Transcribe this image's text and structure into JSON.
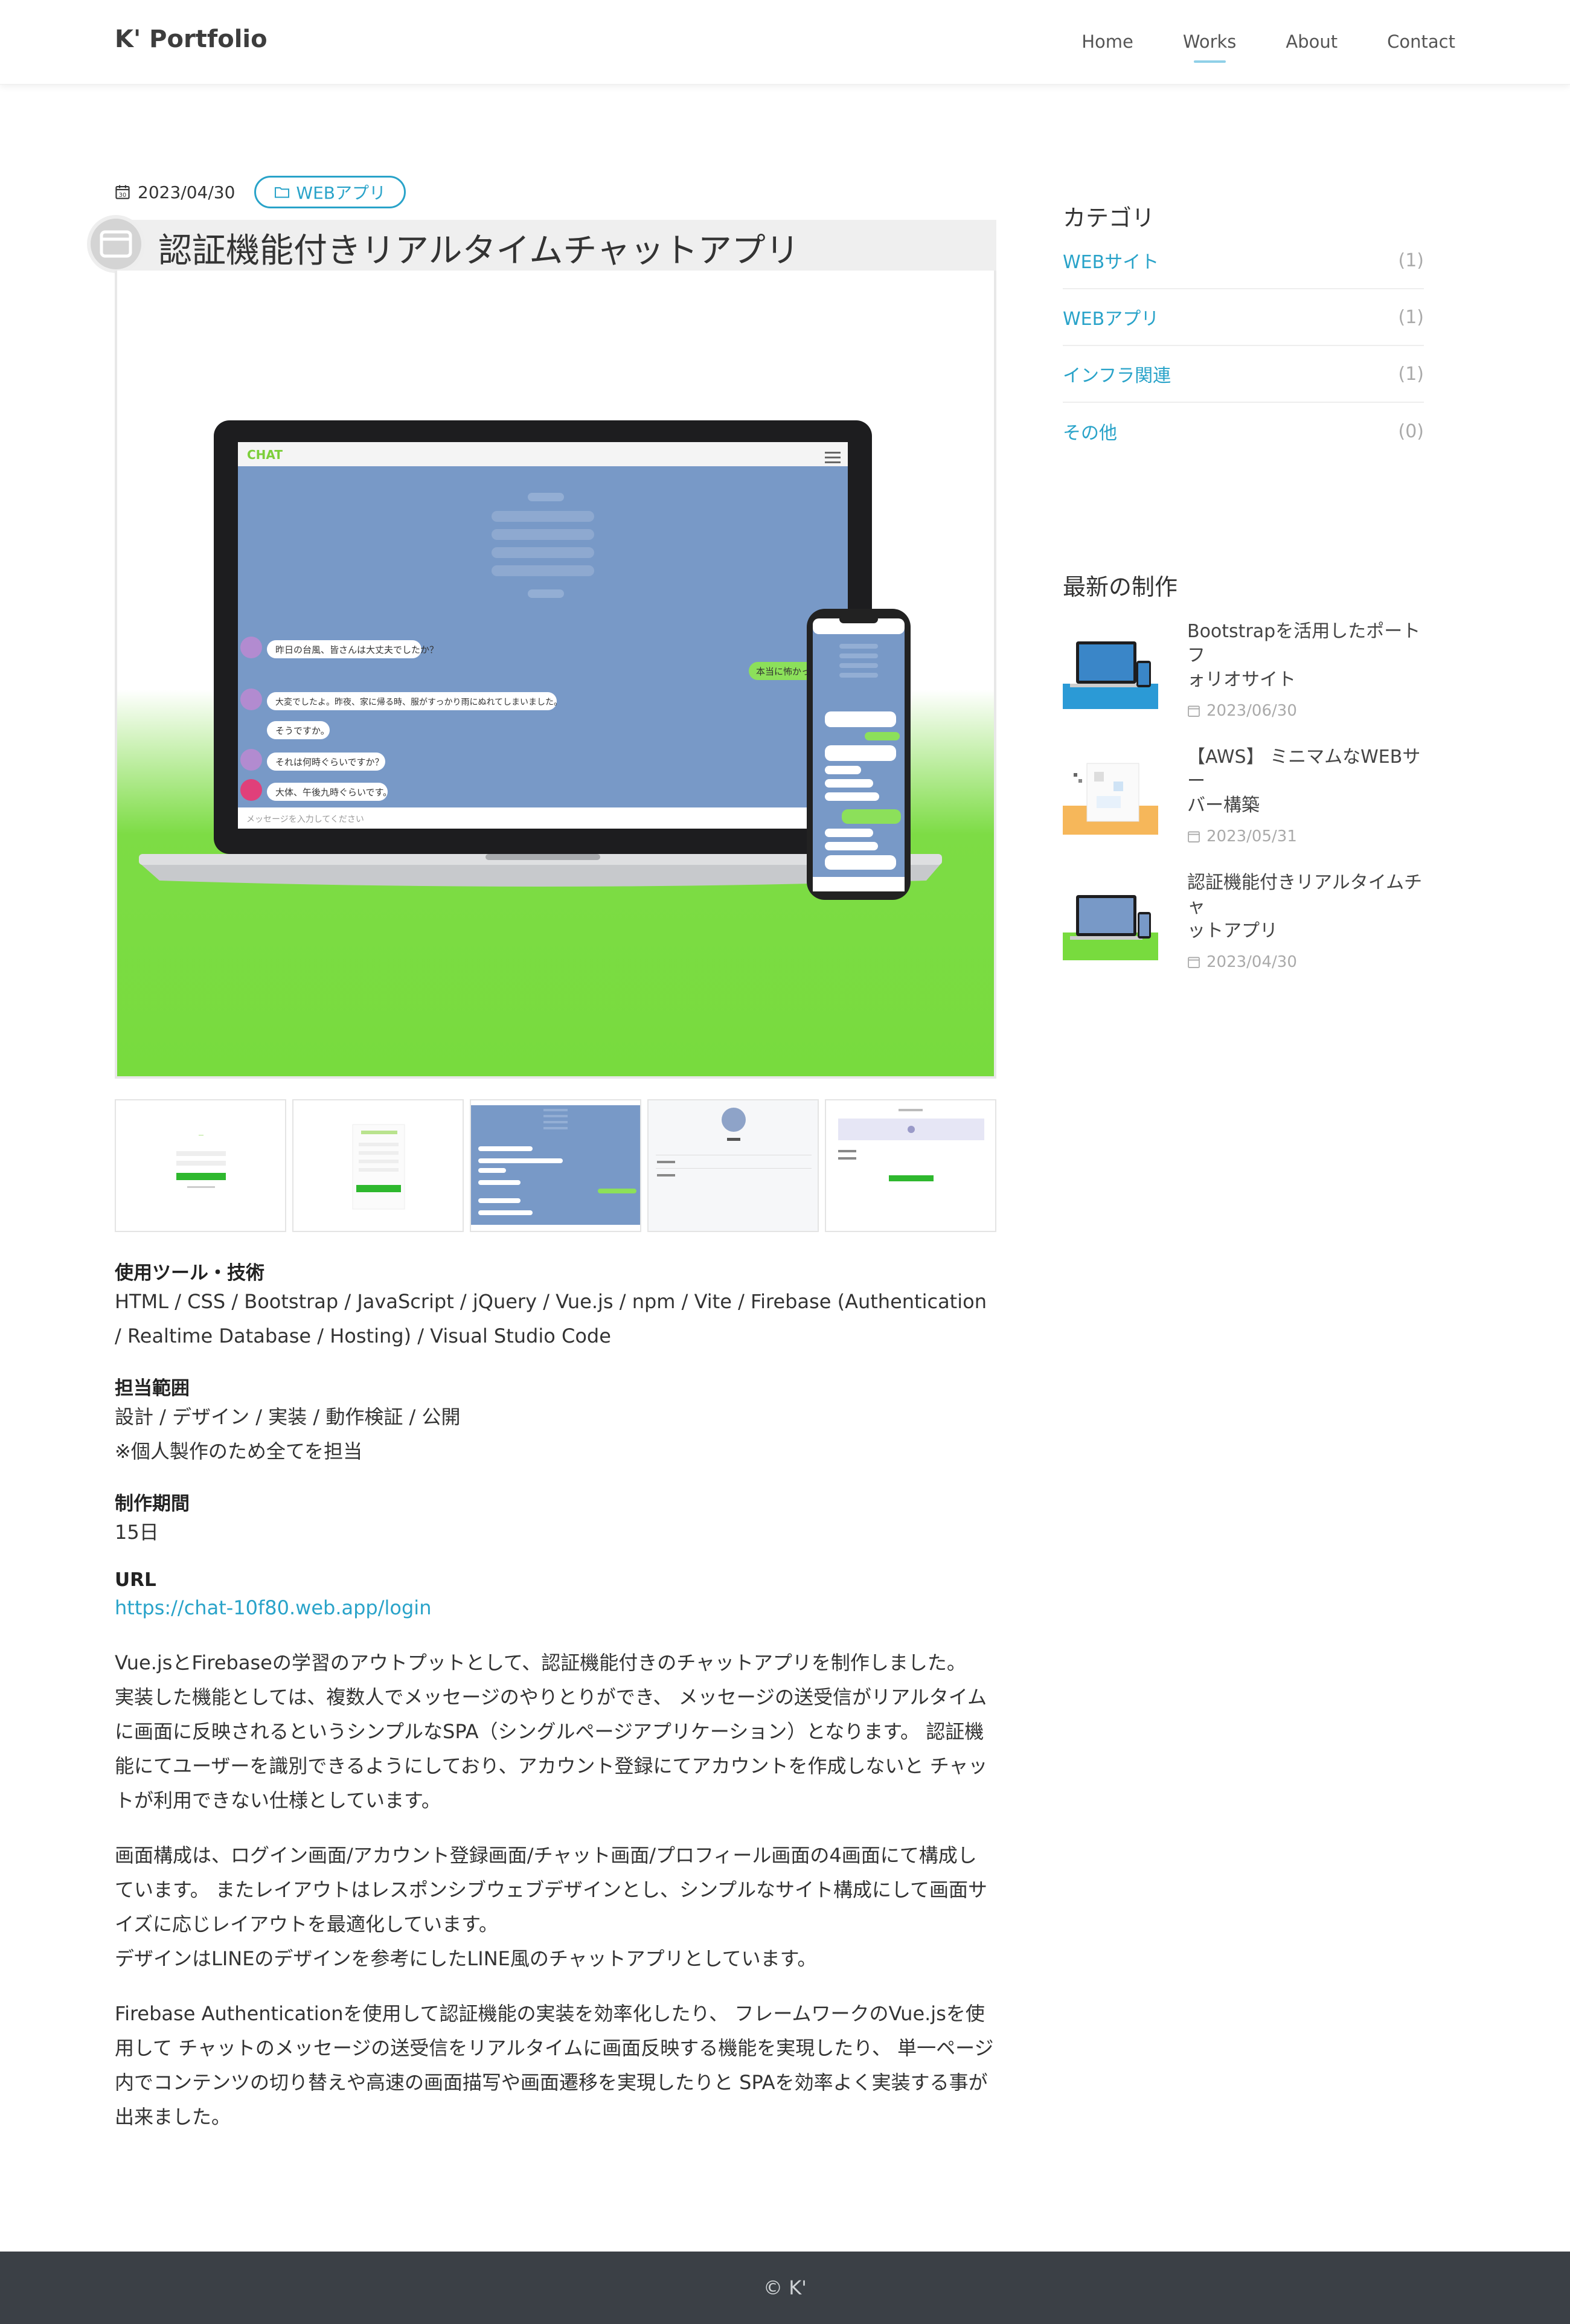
{
  "header": {
    "logo": "K' Portfolio",
    "nav": [
      "Home",
      "Works",
      "About",
      "Contact"
    ],
    "active_nav": "Works"
  },
  "post": {
    "date": "2023/04/30",
    "category": "WEBアプリ",
    "title": "認証機能付きリアルタイムチャットアプリ",
    "hero_icon": "browser-window-icon",
    "tools_label": "使用ツール・技術",
    "tools_line1": "HTML / CSS / Bootstrap / JavaScript / jQuery / Vue.js / npm / Vite / Firebase (Authentication",
    "tools_line2": "/ Realtime Database / Hosting) / Visual Studio Code",
    "scope_label": "担当範囲",
    "scope_line1": "設計 / デザイン / 実装 / 動作検証 / 公開",
    "scope_line2": "※個人製作のため全てを担当",
    "period_label": "制作期間",
    "period": "15日",
    "url_label": "URL",
    "url": "https://chat-10f80.web.app/login",
    "para1": [
      "Vue.jsとFirebaseの学習のアウトプットとして、認証機能付きのチャットアプリを制作しました。",
      "実装した機能としては、複数人でメッセージのやりとりができ、 メッセージの送受信がリアルタイム",
      "に画面に反映されるというシンプルなSPA（シングルページアプリケーション）となります。 認証機",
      "能にてユーザーを識別できるようにしており、アカウント登録にてアカウントを作成しないと チャッ",
      "トが利用できない仕様としています。"
    ],
    "para2": [
      "画面構成は、ログイン画面/アカウント登録画面/チャット画面/プロフィール画面の4画面にて構成し",
      "ています。 またレイアウトはレスポンシブウェブデザインとし、シンプルなサイト構成にして画面サ",
      "イズに応じレイアウトを最適化しています。",
      "デザインはLINEのデザインを参考にしたLINE風のチャットアプリとしています。"
    ],
    "para3": [
      "Firebase Authenticationを使用して認証機能の実装を効率化したり、 フレームワークのVue.jsを使",
      "用して チャットのメッセージの送受信をリアルタイムに画面反映する機能を実現したり、 単一ページ",
      "内でコンテンツの切り替えや高速の画面描写や画面遷移を実現したりと SPAを効率よく実装する事が",
      "出来ました。"
    ]
  },
  "hero_mock": {
    "app_name": "CHAT",
    "input_placeholder": "メッセージを入力してください",
    "messages": [
      "昨日の台風、皆さんは大丈夫でしたか？",
      "大変でしたよ。昨夜、家に帰る時、服がすっかり雨にぬれてしまいました。",
      "そうですか。",
      "それは何時ぐらいですか？",
      "大体、午後九時ぐらいです。"
    ],
    "sent": "本当に怖かった"
  },
  "sidebar": {
    "category_title": "カテゴリ",
    "categories": [
      {
        "name": "WEBサイト",
        "count": "(1)"
      },
      {
        "name": "WEBアプリ",
        "count": "(1)"
      },
      {
        "name": "インフラ関連",
        "count": "(1)"
      },
      {
        "name": "その他",
        "count": "(0)"
      }
    ],
    "recent_title": "最新の制作",
    "recent": [
      {
        "name_line1": "Bootstrapを活用したポートフ",
        "name_line2": "ォリオサイト",
        "date": "2023/06/30"
      },
      {
        "name_line1": "【AWS】 ミニマムなWEBサー",
        "name_line2": "バー構築",
        "date": "2023/05/31"
      },
      {
        "name_line1": "認証機能付きリアルタイムチャ",
        "name_line2": "ットアプリ",
        "date": "2023/04/30"
      }
    ]
  },
  "footer": {
    "copyright": "© K'"
  },
  "colors": {
    "accent": "#29a3c9",
    "hero_green": "#78db3e",
    "chat_bg": "#7899c7",
    "footer_bg": "#3b4046"
  }
}
